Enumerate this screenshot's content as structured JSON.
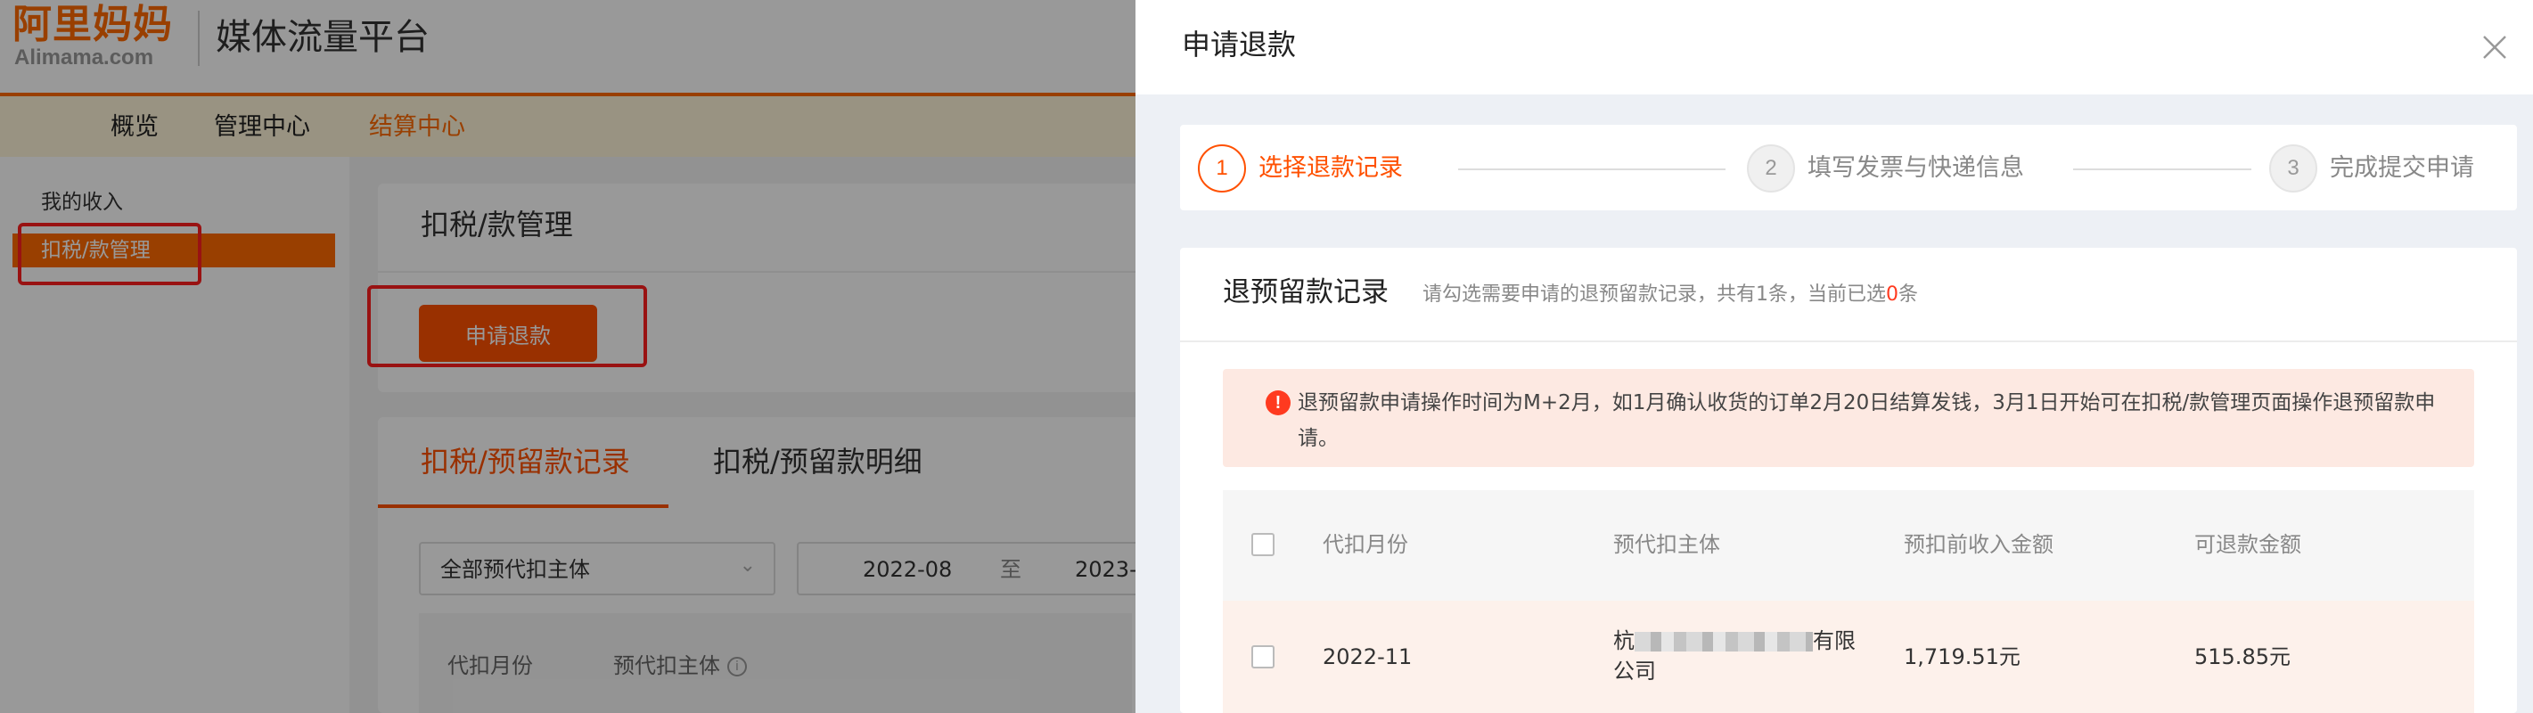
{
  "header": {
    "logo_cn": "阿里妈妈",
    "logo_en": "Alimama.com",
    "platform_title": "媒体流量平台"
  },
  "nav": {
    "items": [
      {
        "label": "概览"
      },
      {
        "label": "管理中心"
      },
      {
        "label": "结算中心"
      }
    ],
    "active": "结算中心"
  },
  "sidebar": {
    "items": [
      {
        "label": "我的收入"
      },
      {
        "label": "扣税/款管理"
      }
    ],
    "active": "扣税/款管理"
  },
  "main": {
    "card_title": "扣税/款管理",
    "apply_button": "申请退款",
    "tabs": [
      {
        "label": "扣税/预留款记录"
      },
      {
        "label": "扣税/预留款明细"
      }
    ],
    "active_tab": "扣税/预留款记录",
    "filter": {
      "entity_select": "全部预代扣主体",
      "date_start": "2022-08",
      "date_sep": "至",
      "date_end": "2023-0"
    },
    "table_headers": [
      "代扣月份",
      "预代扣主体"
    ]
  },
  "drawer": {
    "title": "申请退款",
    "steps": [
      {
        "num": "1",
        "label": "选择退款记录"
      },
      {
        "num": "2",
        "label": "填写发票与快递信息"
      },
      {
        "num": "3",
        "label": "完成提交申请"
      }
    ],
    "current_step": 1,
    "records": {
      "title": "退预留款记录",
      "hint_prefix": "请勾选需要申请的退预留款记录，共有1条，当前已选",
      "selected_count": "0",
      "hint_suffix": "条",
      "notice": "退预留款申请操作时间为M+2月，如1月确认收货的订单2月20日结算发钱，3月1日开始可在扣税/款管理页面操作退预留款申请。",
      "columns": [
        "代扣月份",
        "预代扣主体",
        "预扣前收入金额",
        "可退款金额"
      ],
      "rows": [
        {
          "month": "2022-11",
          "entity_prefix": "杭",
          "entity_suffix": "有限",
          "entity_line2": "公司",
          "income": "1,719.51元",
          "refundable": "515.85元"
        }
      ]
    }
  },
  "colors": {
    "brand": "#ff6a00",
    "accent": "#ff5000",
    "annotation": "#ff1f1f"
  },
  "icons": [
    "close-icon",
    "warning-icon",
    "info-icon",
    "chevron-down-icon",
    "checkbox-icon"
  ]
}
